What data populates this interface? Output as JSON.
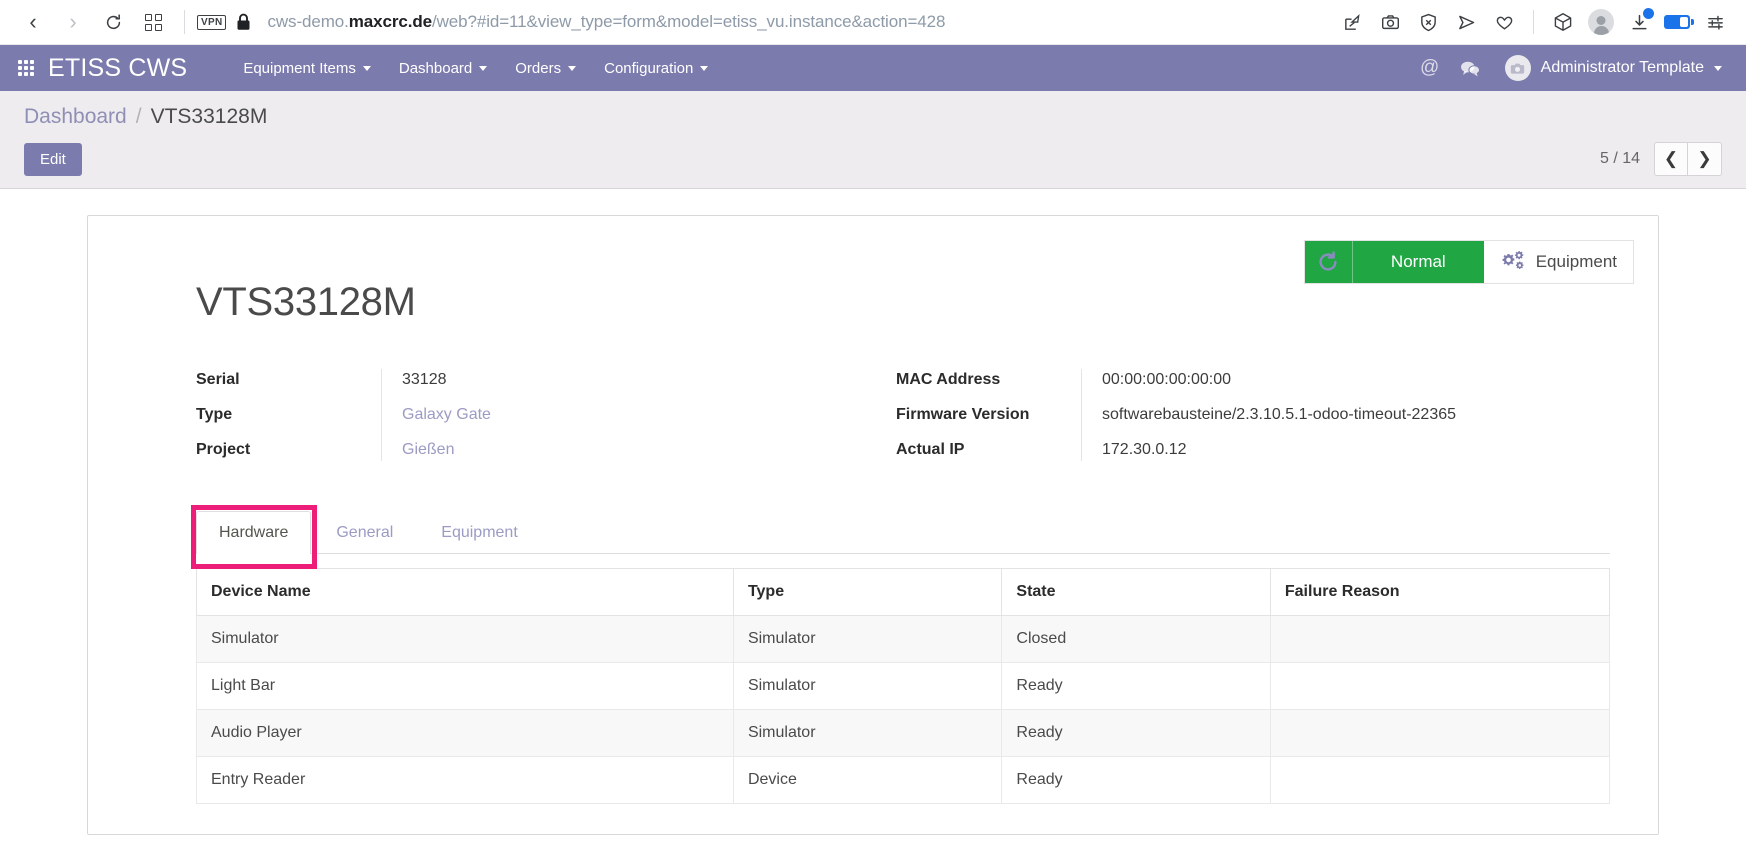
{
  "browser": {
    "back_icon": "chevron-left-icon",
    "forward_icon": "chevron-right-icon",
    "reload_icon": "reload-icon",
    "tabs_icon": "tab-grid-icon",
    "vpn_label": "VPN",
    "lock_icon": "lock-icon",
    "url_prefix": "cws-demo.",
    "url_domain": "maxcrc.de",
    "url_path": "/web?#id=11&view_type=form&model=etiss_vu.instance&action=428",
    "url_full": "cws-demo.maxcrc.de/web?#id=11&view_type=form&model=etiss_vu.instance&action=428",
    "toolbar_icons": [
      "edit-pin-icon",
      "camera-icon",
      "shield-block-icon",
      "send-icon",
      "heart-icon",
      "cube-icon",
      "profile-avatar-icon",
      "downloads-icon",
      "battery-icon",
      "settings-sliders-icon"
    ]
  },
  "navbar": {
    "apps_icon": "apps-grid-icon",
    "brand": "ETISS CWS",
    "menus": [
      {
        "label": "Equipment Items",
        "has_caret": true
      },
      {
        "label": "Dashboard",
        "has_caret": true
      },
      {
        "label": "Orders",
        "has_caret": true
      },
      {
        "label": "Configuration",
        "has_caret": true
      }
    ],
    "mention_icon": "at-sign-icon",
    "messages_icon": "chat-bubbles-icon",
    "user_name": "Administrator Template",
    "user_avatar_icon": "camera-avatar-icon"
  },
  "control_panel": {
    "breadcrumb_root": "Dashboard",
    "breadcrumb_sep": "/",
    "breadcrumb_current": "VTS33128M",
    "edit_label": "Edit",
    "pager_text": "5 / 14",
    "pager_prev_icon": "chevron-left-icon",
    "pager_next_icon": "chevron-right-icon"
  },
  "record": {
    "title": "VTS33128M",
    "status": {
      "refresh_icon": "refresh-circular-icon",
      "label": "Normal",
      "color": "#21a644",
      "equipment_icon": "gears-icon",
      "equipment_label": "Equipment"
    },
    "fields_left": [
      {
        "label": "Serial",
        "value": "33128",
        "is_link": false
      },
      {
        "label": "Type",
        "value": "Galaxy Gate",
        "is_link": true
      },
      {
        "label": "Project",
        "value": "Gießen",
        "is_link": true
      }
    ],
    "fields_right": [
      {
        "label": "MAC Address",
        "value": "00:00:00:00:00:00",
        "is_link": false
      },
      {
        "label": "Firmware Version",
        "value": "softwarebausteine/2.3.10.5.1-odoo-timeout-22365",
        "is_link": false
      },
      {
        "label": "Actual IP",
        "value": "172.30.0.12",
        "is_link": false
      }
    ],
    "tabs": [
      {
        "label": "Hardware",
        "active": true
      },
      {
        "label": "General",
        "active": false
      },
      {
        "label": "Equipment",
        "active": false
      }
    ],
    "highlight_color": "#ec1e79",
    "table": {
      "columns": [
        "Device Name",
        "Type",
        "State",
        "Failure Reason"
      ],
      "rows": [
        {
          "device_name": "Simulator",
          "type": "Simulator",
          "state": "Closed",
          "failure_reason": ""
        },
        {
          "device_name": "Light Bar",
          "type": "Simulator",
          "state": "Ready",
          "failure_reason": ""
        },
        {
          "device_name": "Audio Player",
          "type": "Simulator",
          "state": "Ready",
          "failure_reason": ""
        },
        {
          "device_name": "Entry Reader",
          "type": "Device",
          "state": "Ready",
          "failure_reason": ""
        }
      ]
    }
  }
}
